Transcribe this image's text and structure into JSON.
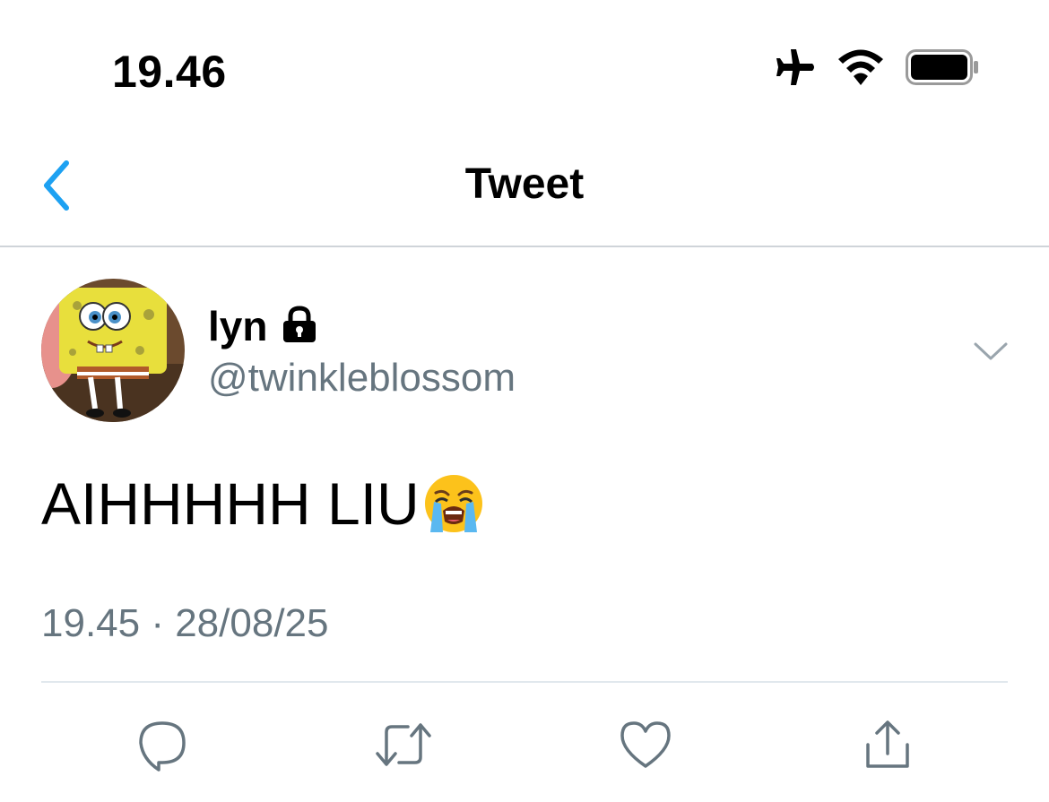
{
  "status_bar": {
    "time": "19.46",
    "icons": [
      "airplane-icon",
      "wifi-icon",
      "battery-icon"
    ]
  },
  "nav": {
    "title": "Tweet",
    "back_icon": "chevron-left-icon"
  },
  "tweet": {
    "display_name": "lyn",
    "protected_icon": "lock-icon",
    "handle": "@twinkleblossom",
    "text": "AIHHHHH LIU",
    "emoji": "loudly-crying-face",
    "timestamp": "19.45 · 28/08/25",
    "menu_icon": "chevron-down-icon"
  },
  "actions": [
    {
      "name": "reply",
      "icon": "reply-icon"
    },
    {
      "name": "retweet",
      "icon": "retweet-icon"
    },
    {
      "name": "like",
      "icon": "heart-icon"
    },
    {
      "name": "share",
      "icon": "share-icon"
    }
  ],
  "colors": {
    "accent": "#1da1f2",
    "secondary_text": "#66757f",
    "divider": "#e1e8ed"
  }
}
